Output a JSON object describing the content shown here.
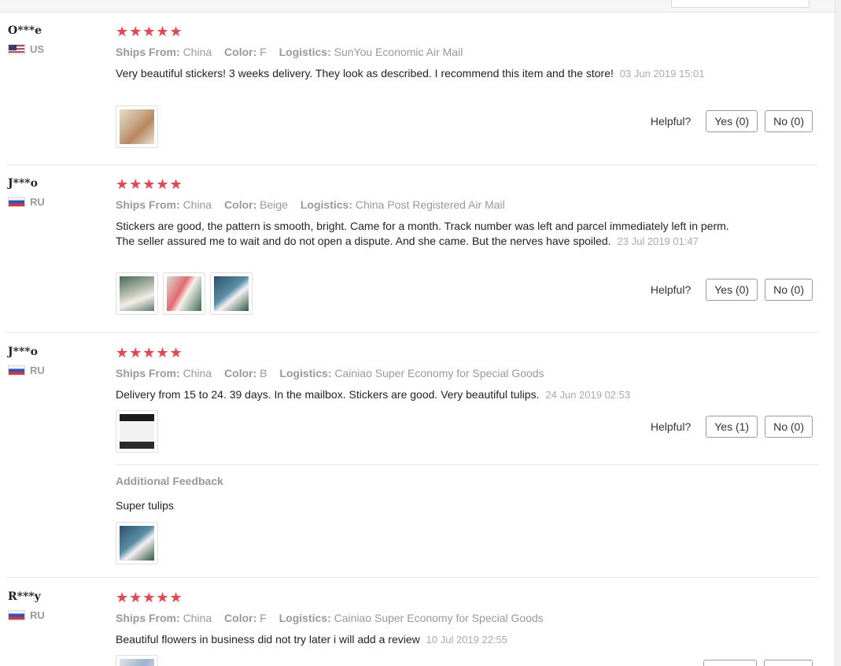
{
  "labels": {
    "ships_from": "Ships From:",
    "color": "Color:",
    "logistics": "Logistics:",
    "helpful": "Helpful?",
    "additional_feedback": "Additional Feedback"
  },
  "stars": "★★★★★",
  "reviews": [
    {
      "username": "O***e",
      "country": "US",
      "rating": 5,
      "ships_from": "China",
      "color": "F",
      "logistics": "SunYou Economic Air Mail",
      "text": "Very beautiful stickers! 3 weeks delivery. They look as described. I recommend this item and the store!",
      "date": "03 Jun 2019 15:01",
      "photos": 1,
      "yes": "Yes (0)",
      "no": "No (0)"
    },
    {
      "username": "J***o",
      "country": "RU",
      "rating": 5,
      "ships_from": "China",
      "color": "Beige",
      "logistics": "China Post Registered Air Mail",
      "text": "Stickers are good, the pattern is smooth, bright. Came for a month. Track number was left and parcel immediately left in perm. The seller assured me to wait and do not open a dispute. And she came. But the nerves have spoiled.",
      "date": "23 Jul 2019 01:47",
      "photos": 3,
      "yes": "Yes (0)",
      "no": "No (0)"
    },
    {
      "username": "J***o",
      "country": "RU",
      "rating": 5,
      "ships_from": "China",
      "color": "B",
      "logistics": "Cainiao Super Economy for Special Goods",
      "text": "Delivery from 15 to 24. 39 days. In the mailbox. Stickers are good. Very beautiful tulips.",
      "date": "24 Jun 2019 02:53",
      "photos": 1,
      "yes": "Yes (1)",
      "no": "No (0)",
      "additional_feedback": "Super tulips",
      "additional_photos": 1
    },
    {
      "username": "R***y",
      "country": "RU",
      "rating": 5,
      "ships_from": "China",
      "color": "F",
      "logistics": "Cainiao Super Economy for Special Goods",
      "text": "Beautiful flowers in business did not try later i will add a review",
      "date": "10 Jul 2019 22:55",
      "photos": 1
    }
  ]
}
